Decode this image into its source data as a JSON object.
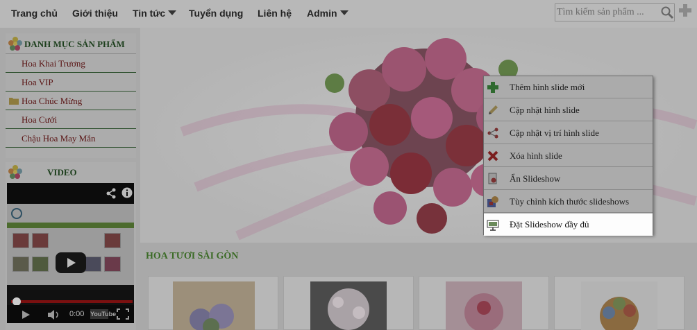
{
  "nav": {
    "items": [
      "Trang chủ",
      "Giới thiệu",
      "Tin tức",
      "Tuyển dụng",
      "Liên hệ",
      "Admin"
    ],
    "search_placeholder": "Tìm kiếm sản phẩm ..."
  },
  "sidebar": {
    "title": "DANH MỤC SẢN PHẨM",
    "categories": [
      "Hoa Khai Trương",
      "Hoa VIP",
      "Hoa Chúc Mừng",
      "Hoa Cưới",
      "Chậu Hoa May Mắn"
    ],
    "video_title": "VIDEO",
    "video_time": "0:00"
  },
  "main": {
    "section_title": "HOA TƯƠI SÀI GÒN"
  },
  "context_menu": {
    "items": [
      {
        "label": "Thêm hình slide mới",
        "icon": "plus-icon"
      },
      {
        "label": "Cập nhật hình slide",
        "icon": "pencil-icon"
      },
      {
        "label": "Cập nhật vị trí hình slide",
        "icon": "position-icon"
      },
      {
        "label": "Xóa hình slide",
        "icon": "delete-x-icon"
      },
      {
        "label": "Ẩn Slideshow",
        "icon": "hide-icon"
      },
      {
        "label": "Tùy chỉnh kích thước slideshows",
        "icon": "resize-icon"
      },
      {
        "label": "Đặt Slideshow đầy đủ",
        "icon": "slideshow-full-icon"
      }
    ],
    "active_index": 6
  }
}
